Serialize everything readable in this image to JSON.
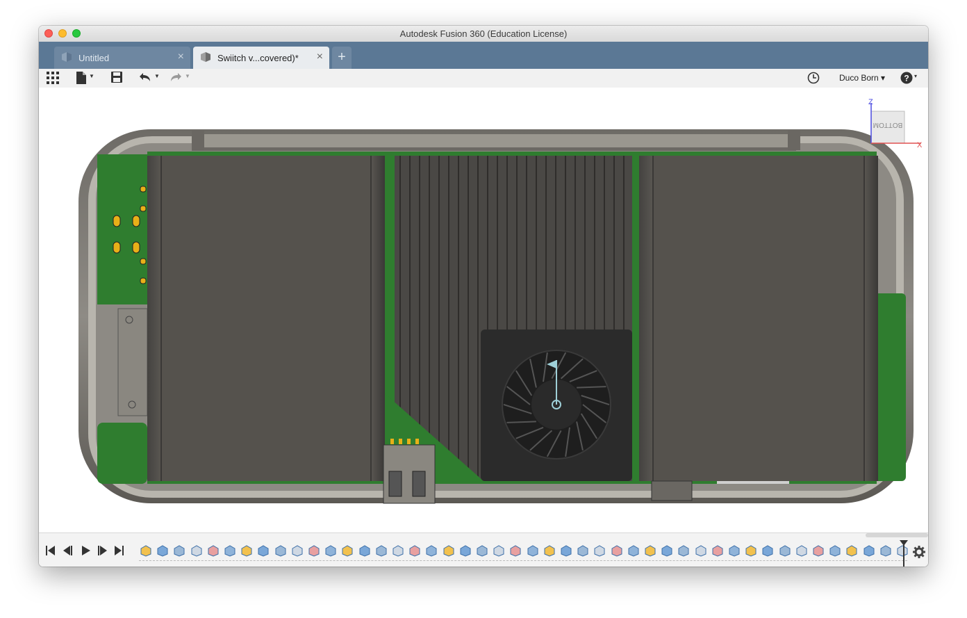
{
  "window": {
    "title": "Autodesk Fusion 360 (Education License)"
  },
  "tabs": [
    {
      "label": "Untitled",
      "active": false
    },
    {
      "label": "Swiitch v...covered)*",
      "active": true
    }
  ],
  "new_tab_label": "+",
  "toolbar": {
    "icons": [
      "apps-grid-icon",
      "file-icon",
      "save-icon",
      "undo-icon",
      "redo-icon",
      "history-icon",
      "help-icon"
    ],
    "user_name": "Duco Born ▾",
    "help_caret": "▾"
  },
  "viewcube": {
    "face_label": "BOTTOM",
    "axis_z": "Z",
    "axis_x": "X",
    "colors": {
      "z_axis": "#4a4ae0",
      "x_axis": "#e05050"
    }
  },
  "model_colors": {
    "enclosure": "#8a8780",
    "pcb": "#2e7d32",
    "battery": "#55524d",
    "heatsink": "#4a4845",
    "fan": "#2b2b2b",
    "pads": "#e8b018"
  },
  "timeline": {
    "playback": [
      "go-to-start-icon",
      "step-back-icon",
      "play-icon",
      "step-forward-icon",
      "go-to-end-icon"
    ],
    "feature_count": 46,
    "settings_icon": "gear-icon"
  }
}
